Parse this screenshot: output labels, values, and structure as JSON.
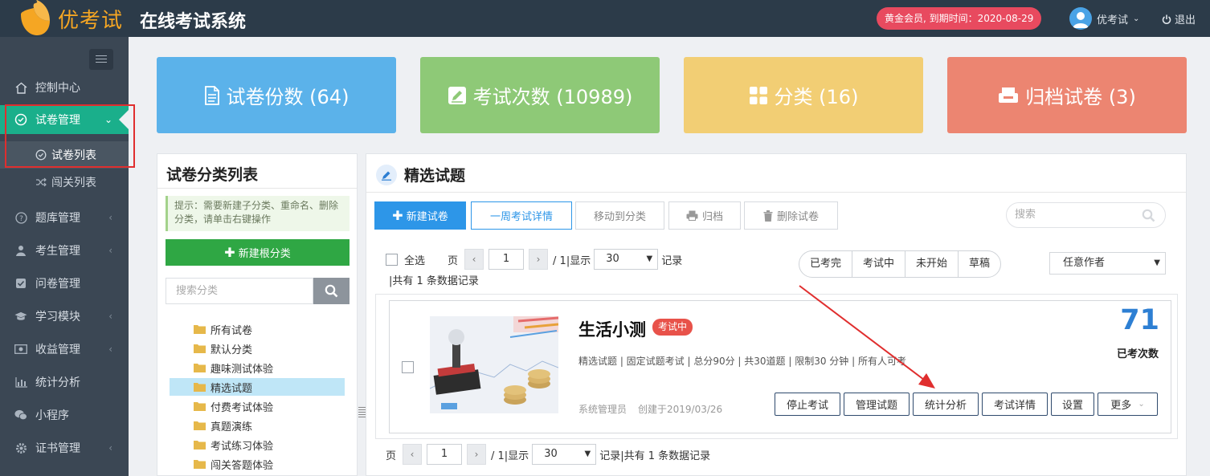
{
  "brand": {
    "logo_text": "优考试",
    "app_title": "在线考试系统"
  },
  "header": {
    "member_badge": "黄金会员, 到期时间：2020-08-29",
    "username": "优考试",
    "logout_label": "退出"
  },
  "sidebar": {
    "items": [
      {
        "label": "控制中心",
        "icon": "dashboard-icon"
      },
      {
        "label": "试卷管理",
        "icon": "check-circle-icon",
        "expanded": true
      },
      {
        "label": "题库管理",
        "icon": "question-icon"
      },
      {
        "label": "考生管理",
        "icon": "user-icon"
      },
      {
        "label": "问卷管理",
        "icon": "checkbox-icon"
      },
      {
        "label": "学习模块",
        "icon": "graduation-icon"
      },
      {
        "label": "收益管理",
        "icon": "money-icon"
      },
      {
        "label": "统计分析",
        "icon": "bar-chart-icon"
      },
      {
        "label": "小程序",
        "icon": "wechat-icon"
      },
      {
        "label": "证书管理",
        "icon": "certificate-icon"
      }
    ],
    "subitems": [
      {
        "label": "试卷列表",
        "icon": "check-circle-icon",
        "active": true
      },
      {
        "label": "闯关列表",
        "icon": "shuffle-icon"
      }
    ]
  },
  "stats": [
    {
      "label": "试卷份数 (64)",
      "color": "#5bb2ea",
      "icon": "document-icon"
    },
    {
      "label": "考试次数 (10989)",
      "color": "#8ec977",
      "icon": "edit-icon"
    },
    {
      "label": "分类 (16)",
      "color": "#f2ce74",
      "icon": "grid-icon"
    },
    {
      "label": "归档试卷 (3)",
      "color": "#ec8571",
      "icon": "archive-icon"
    }
  ],
  "categories": {
    "title": "试卷分类列表",
    "tip": "提示：需要新建子分类、重命名、删除分类，请单击右键操作",
    "new_root_label": "新建根分类",
    "search_placeholder": "搜索分类",
    "items": [
      "所有试卷",
      "默认分类",
      "趣味测试体验",
      "精选试题",
      "付费考试体验",
      "真题演练",
      "考试练习体验",
      "闯关答题体验"
    ],
    "selected": "精选试题"
  },
  "main": {
    "title": "精选试题",
    "toolbar": {
      "new_exam": "新建试卷",
      "week_detail": "一周考试详情",
      "move_to": "移动到分类",
      "archive": "归档",
      "delete": "删除试卷"
    },
    "search_placeholder": "搜索",
    "pager_top": {
      "select_all": "全选",
      "page_label": "页",
      "page_value": "1",
      "total_pages": "/ 1|显示",
      "page_size": "30",
      "records_label": "记录",
      "summary": "|共有 1 条数据记录"
    },
    "filters": [
      "已考完",
      "考试中",
      "未开始",
      "草稿"
    ],
    "author_select": "任意作者",
    "exam": {
      "title": "生活小测",
      "status": "考试中",
      "meta": "精选试题 | 固定试题考试 | 总分90分 | 共30道题 | 限制30 分钟 | 所有人可考",
      "creator": "系统管理员",
      "created": "创建于2019/03/26",
      "count": "71",
      "count_label": "已考次数",
      "actions": [
        "停止考试",
        "管理试题",
        "统计分析",
        "考试详情",
        "设置",
        "更多"
      ]
    },
    "pager_bottom": {
      "page_label": "页",
      "page_value": "1",
      "total_pages": "/ 1|显示",
      "page_size": "30",
      "summary": "记录|共有 1 条数据记录"
    }
  }
}
